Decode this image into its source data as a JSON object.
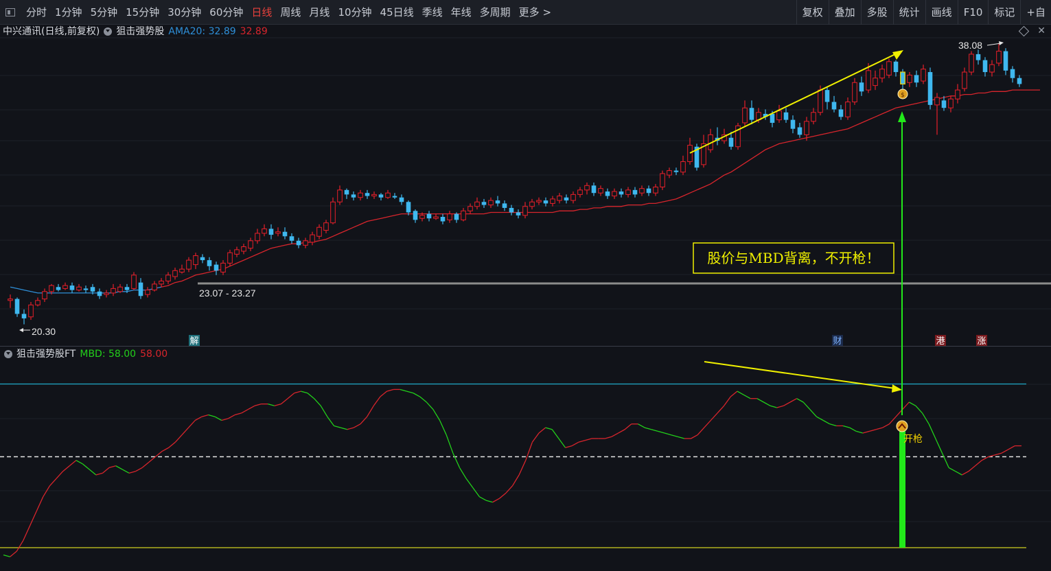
{
  "toolbar": {
    "periods": [
      "分时",
      "1分钟",
      "5分钟",
      "15分钟",
      "30分钟",
      "60分钟",
      "日线",
      "周线",
      "月线",
      "10分钟",
      "45日线",
      "季线",
      "年线",
      "多周期",
      "更多 >"
    ],
    "active_period": "日线",
    "buttons": [
      "复权",
      "叠加",
      "多股",
      "统计",
      "画线",
      "F10",
      "标记",
      "+自"
    ]
  },
  "main_panel": {
    "title": "中兴通讯(日线,前复权)",
    "indicator_name": "狙击强势股",
    "ama_label": "AMA20: 32.89",
    "ama_value2": "32.89",
    "high_label": "38.08",
    "low_label": "20.30",
    "range_label": "23.07 - 23.27",
    "event_labels": {
      "jie": "解",
      "cai": "财",
      "gang": "港",
      "zhang": "涨"
    },
    "divergence_note": "股价与MBD背离，不开枪！",
    "signal_icon": "money-bag-icon"
  },
  "sub_panel": {
    "indicator_name": "狙击强势股FT",
    "mbd_label": "MBD: 58.00",
    "mbd_value2": "58.00",
    "signal_label": "开枪",
    "signal_icon": "up-chevron-icon"
  },
  "colors": {
    "up": "#e8202a",
    "down": "#3fb8ef",
    "ma_red": "#d8252c",
    "ma_blue": "#2e8fd8",
    "osc_green": "#22d01a",
    "osc_red": "#d8252c",
    "annotation_yellow": "#f0f000",
    "signal_green": "#22e81a",
    "cyan_line": "#1ea8c8",
    "gray_line": "#8c8c8c"
  },
  "chart_data": [
    {
      "type": "candlestick",
      "title": "中兴通讯(日线,前复权)",
      "yrange": [
        19.5,
        39.5
      ],
      "candles": [
        [
          21.9,
          22.0,
          22.3,
          21.4
        ],
        [
          22.0,
          21.0,
          22.1,
          20.8
        ],
        [
          21.0,
          20.7,
          21.3,
          20.3
        ],
        [
          20.8,
          21.6,
          21.8,
          20.6
        ],
        [
          21.6,
          21.9,
          22.1,
          21.5
        ],
        [
          22.0,
          22.5,
          22.7,
          21.8
        ],
        [
          22.5,
          22.9,
          23.0,
          22.3
        ],
        [
          22.8,
          22.6,
          23.0,
          22.5
        ],
        [
          22.7,
          22.9,
          23.1,
          22.6
        ],
        [
          22.9,
          22.6,
          23.1,
          22.4
        ],
        [
          22.6,
          22.8,
          23.0,
          22.5
        ],
        [
          22.7,
          22.6,
          22.9,
          22.4
        ],
        [
          22.8,
          22.5,
          23.0,
          22.3
        ],
        [
          22.5,
          22.2,
          22.7,
          22.0
        ],
        [
          22.3,
          22.4,
          22.6,
          22.1
        ],
        [
          22.4,
          22.7,
          23.0,
          22.2
        ],
        [
          22.5,
          22.8,
          23.0,
          22.4
        ],
        [
          22.8,
          22.6,
          23.0,
          22.4
        ],
        [
          22.7,
          23.6,
          23.8,
          22.6
        ],
        [
          23.1,
          22.2,
          23.4,
          22.0
        ],
        [
          22.3,
          22.6,
          22.8,
          22.1
        ],
        [
          22.6,
          23.0,
          23.2,
          22.5
        ],
        [
          23.0,
          23.2,
          23.4,
          22.8
        ],
        [
          23.2,
          23.6,
          23.8,
          23.0
        ],
        [
          23.5,
          23.9,
          24.1,
          23.3
        ],
        [
          23.8,
          24.0,
          24.3,
          23.7
        ],
        [
          24.0,
          24.6,
          24.8,
          23.8
        ],
        [
          24.3,
          24.9,
          25.1,
          24.0
        ],
        [
          24.8,
          24.6,
          25.0,
          24.4
        ],
        [
          24.6,
          24.2,
          24.8,
          23.9
        ],
        [
          24.3,
          23.9,
          24.5,
          23.6
        ],
        [
          23.8,
          24.4,
          24.6,
          23.6
        ],
        [
          24.4,
          25.1,
          25.3,
          24.2
        ],
        [
          25.0,
          25.3,
          25.5,
          24.8
        ],
        [
          25.2,
          25.5,
          25.7,
          25.0
        ],
        [
          25.4,
          25.9,
          26.1,
          25.2
        ],
        [
          25.9,
          26.4,
          26.7,
          25.7
        ],
        [
          26.4,
          26.7,
          27.0,
          26.2
        ],
        [
          26.7,
          26.3,
          27.0,
          26.0
        ],
        [
          26.4,
          26.5,
          26.8,
          26.2
        ],
        [
          26.5,
          26.2,
          26.8,
          26.0
        ],
        [
          26.2,
          25.9,
          26.4,
          25.7
        ],
        [
          25.9,
          25.6,
          26.1,
          25.4
        ],
        [
          25.6,
          25.9,
          26.1,
          25.4
        ],
        [
          25.8,
          26.3,
          26.5,
          25.6
        ],
        [
          26.2,
          26.8,
          27.0,
          26.0
        ],
        [
          26.6,
          27.1,
          27.3,
          26.4
        ],
        [
          27.1,
          28.5,
          28.8,
          27.0
        ],
        [
          28.5,
          29.3,
          29.6,
          28.3
        ],
        [
          29.3,
          29.0,
          29.4,
          28.7
        ],
        [
          29.0,
          28.8,
          29.2,
          28.6
        ],
        [
          28.8,
          29.1,
          29.3,
          28.6
        ],
        [
          29.1,
          28.9,
          29.3,
          28.7
        ],
        [
          28.9,
          29.0,
          29.2,
          28.7
        ],
        [
          29.0,
          28.8,
          29.1,
          28.6
        ],
        [
          28.8,
          29.1,
          29.3,
          28.7
        ],
        [
          28.9,
          28.8,
          29.1,
          28.7
        ],
        [
          28.8,
          28.5,
          29.0,
          28.3
        ],
        [
          28.5,
          27.8,
          28.6,
          27.6
        ],
        [
          27.9,
          27.3,
          28.0,
          27.1
        ],
        [
          27.4,
          27.6,
          27.8,
          27.2
        ],
        [
          27.7,
          27.4,
          27.9,
          27.2
        ],
        [
          27.4,
          27.5,
          27.7,
          27.3
        ],
        [
          27.5,
          27.2,
          27.7,
          27.0
        ],
        [
          27.3,
          27.7,
          27.9,
          27.1
        ],
        [
          27.7,
          27.3,
          27.8,
          27.1
        ],
        [
          27.3,
          27.9,
          28.1,
          27.2
        ],
        [
          27.9,
          28.2,
          28.4,
          27.7
        ],
        [
          28.2,
          28.5,
          28.8,
          28.0
        ],
        [
          28.5,
          28.3,
          28.7,
          28.1
        ],
        [
          28.3,
          28.6,
          28.8,
          28.1
        ],
        [
          28.6,
          28.4,
          28.9,
          28.2
        ],
        [
          28.4,
          28.1,
          28.6,
          27.9
        ],
        [
          28.1,
          27.8,
          28.3,
          27.6
        ],
        [
          27.8,
          27.6,
          28.0,
          27.4
        ],
        [
          27.6,
          28.2,
          28.5,
          27.4
        ],
        [
          28.2,
          28.5,
          28.7,
          28.0
        ],
        [
          28.5,
          28.6,
          28.8,
          28.3
        ],
        [
          28.6,
          28.4,
          28.8,
          28.2
        ],
        [
          28.4,
          28.7,
          28.9,
          28.2
        ],
        [
          28.6,
          28.9,
          29.1,
          28.4
        ],
        [
          28.8,
          28.6,
          29.0,
          28.4
        ],
        [
          28.6,
          29.0,
          29.2,
          28.4
        ],
        [
          29.0,
          29.3,
          29.5,
          28.8
        ],
        [
          29.3,
          29.6,
          29.8,
          29.0
        ],
        [
          29.6,
          29.1,
          29.8,
          28.9
        ],
        [
          29.1,
          29.4,
          29.6,
          28.9
        ],
        [
          29.2,
          28.9,
          29.4,
          28.7
        ],
        [
          28.9,
          29.2,
          29.4,
          28.7
        ],
        [
          29.2,
          29.0,
          29.4,
          28.8
        ],
        [
          29.0,
          29.3,
          29.5,
          28.8
        ],
        [
          29.3,
          29.0,
          29.5,
          28.8
        ],
        [
          29.1,
          29.4,
          29.6,
          28.9
        ],
        [
          29.4,
          29.1,
          29.6,
          28.9
        ],
        [
          29.1,
          29.5,
          29.7,
          28.9
        ],
        [
          29.5,
          30.4,
          30.6,
          29.3
        ],
        [
          30.3,
          30.6,
          30.8,
          30.1
        ],
        [
          30.6,
          30.5,
          30.8,
          30.3
        ],
        [
          30.5,
          31.2,
          31.6,
          30.3
        ],
        [
          31.2,
          32.3,
          32.8,
          31.0
        ],
        [
          32.2,
          30.8,
          32.4,
          30.6
        ],
        [
          31.0,
          32.4,
          33.0,
          30.8
        ],
        [
          32.0,
          33.0,
          33.4,
          31.8
        ],
        [
          32.8,
          32.6,
          33.5,
          32.3
        ],
        [
          32.6,
          33.0,
          33.4,
          32.4
        ],
        [
          32.8,
          32.2,
          33.2,
          32.0
        ],
        [
          32.2,
          33.6,
          33.8,
          32.0
        ],
        [
          33.8,
          34.8,
          35.3,
          33.6
        ],
        [
          34.8,
          34.0,
          35.3,
          33.7
        ],
        [
          34.0,
          34.5,
          34.8,
          33.8
        ],
        [
          34.4,
          34.2,
          34.7,
          34.0
        ],
        [
          34.4,
          33.8,
          34.6,
          33.5
        ],
        [
          34.0,
          34.6,
          35.0,
          33.8
        ],
        [
          34.5,
          34.0,
          34.8,
          33.8
        ],
        [
          34.0,
          33.4,
          34.3,
          33.1
        ],
        [
          33.5,
          33.0,
          33.8,
          32.8
        ],
        [
          33.0,
          33.9,
          34.2,
          32.6
        ],
        [
          33.9,
          34.5,
          34.8,
          33.7
        ],
        [
          34.5,
          36.0,
          36.3,
          34.3
        ],
        [
          36.0,
          35.2,
          36.2,
          34.7
        ],
        [
          35.2,
          34.7,
          35.6,
          34.5
        ],
        [
          34.7,
          34.2,
          35.0,
          34.0
        ],
        [
          34.2,
          35.2,
          35.5,
          34.0
        ],
        [
          35.2,
          36.5,
          36.8,
          35.0
        ],
        [
          36.5,
          35.9,
          36.9,
          35.6
        ],
        [
          36.0,
          37.3,
          37.8,
          35.8
        ],
        [
          36.3,
          36.8,
          37.3,
          36.0
        ],
        [
          36.8,
          37.4,
          37.7,
          36.5
        ],
        [
          37.0,
          37.9,
          38.1,
          36.8
        ],
        [
          37.9,
          37.2,
          38.0,
          36.9
        ],
        [
          37.2,
          36.4,
          37.4,
          36.0
        ],
        [
          36.5,
          37.0,
          37.2,
          36.2
        ],
        [
          37.0,
          36.5,
          37.3,
          36.2
        ],
        [
          36.6,
          37.4,
          37.7,
          36.4
        ],
        [
          37.2,
          35.0,
          37.5,
          34.7
        ],
        [
          35.0,
          35.5,
          35.8,
          33.0
        ],
        [
          35.3,
          34.8,
          35.6,
          34.6
        ],
        [
          34.8,
          35.4,
          35.6,
          34.5
        ],
        [
          35.4,
          36.0,
          36.4,
          35.1
        ],
        [
          36.1,
          37.2,
          37.5,
          35.9
        ],
        [
          37.2,
          38.4,
          38.6,
          37.0
        ],
        [
          38.4,
          38.0,
          38.7,
          37.7
        ],
        [
          38.0,
          37.2,
          38.2,
          36.9
        ],
        [
          37.2,
          37.7,
          38.0,
          36.9
        ],
        [
          37.8,
          38.6,
          39.1,
          37.6
        ],
        [
          38.6,
          37.3,
          38.8,
          37.0
        ],
        [
          37.4,
          36.8,
          37.6,
          36.5
        ],
        [
          36.8,
          36.4,
          37.0,
          36.2
        ]
      ],
      "ama20": [
        22.8,
        22.7,
        22.6,
        22.5,
        22.4,
        22.4,
        22.4,
        22.4,
        22.4,
        22.4,
        22.4,
        22.4,
        22.4,
        22.4,
        22.4,
        22.4,
        22.5,
        22.5,
        22.6,
        22.6,
        22.6,
        22.7,
        22.8,
        22.9,
        23.1,
        23.2,
        23.4,
        23.6,
        23.7,
        23.8,
        23.9,
        24.0,
        24.2,
        24.4,
        24.6,
        24.8,
        25.0,
        25.2,
        25.4,
        25.5,
        25.6,
        25.7,
        25.7,
        25.8,
        25.8,
        25.9,
        26.0,
        26.2,
        26.4,
        26.6,
        26.8,
        27.0,
        27.2,
        27.3,
        27.4,
        27.5,
        27.6,
        27.7,
        27.7,
        27.7,
        27.7,
        27.7,
        27.7,
        27.7,
        27.7,
        27.7,
        27.7,
        27.7,
        27.7,
        27.7,
        27.8,
        27.8,
        27.8,
        27.8,
        27.8,
        27.8,
        27.8,
        27.8,
        27.8,
        27.8,
        27.9,
        27.9,
        27.9,
        28.0,
        28.0,
        28.1,
        28.1,
        28.2,
        28.2,
        28.2,
        28.3,
        28.3,
        28.3,
        28.4,
        28.4,
        28.5,
        28.6,
        28.7,
        28.9,
        29.1,
        29.3,
        29.5,
        29.7,
        30.0,
        30.3,
        30.5,
        30.8,
        31.1,
        31.4,
        31.7,
        32.0,
        32.2,
        32.4,
        32.5,
        32.6,
        32.7,
        32.8,
        32.9,
        33.0,
        33.1,
        33.2,
        33.3,
        33.4,
        33.6,
        33.8,
        34.0,
        34.2,
        34.4,
        34.6,
        34.8,
        34.9,
        35.0,
        35.1,
        35.2,
        35.3,
        35.4,
        35.5,
        35.6,
        35.6,
        35.7,
        35.7,
        35.8,
        35.8,
        35.9,
        35.9,
        35.9,
        36.0,
        36.0,
        36.0,
        36.0,
        36.0
      ]
    },
    {
      "type": "line",
      "title": "狙击强势股FT",
      "yrange": [
        0,
        100
      ],
      "reference_lines": [
        90,
        50,
        0
      ],
      "mbd": [
        -4,
        -5,
        -2,
        4,
        12,
        20,
        28,
        34,
        38,
        42,
        45,
        48,
        46,
        43,
        40,
        41,
        44,
        45,
        43,
        41,
        42,
        44,
        47,
        50,
        53,
        55,
        58,
        62,
        66,
        70,
        72,
        73,
        72,
        70,
        71,
        73,
        74,
        76,
        78,
        79,
        79,
        78,
        79,
        82,
        85,
        86,
        85,
        82,
        78,
        72,
        67,
        66,
        65,
        66,
        68,
        72,
        78,
        83,
        86,
        87,
        87,
        86,
        85,
        83,
        80,
        76,
        70,
        62,
        52,
        44,
        38,
        33,
        28,
        26,
        25,
        27,
        30,
        34,
        40,
        48,
        58,
        63,
        66,
        65,
        60,
        55,
        56,
        58,
        59,
        60,
        60,
        60,
        61,
        63,
        65,
        68,
        68,
        66,
        65,
        64,
        63,
        62,
        61,
        60,
        60,
        62,
        66,
        70,
        74,
        78,
        83,
        86,
        84,
        82,
        82,
        80,
        78,
        77,
        78,
        80,
        82,
        80,
        76,
        72,
        70,
        68,
        67,
        67,
        66,
        64,
        63,
        64,
        65,
        66,
        68,
        72,
        76,
        80,
        78,
        74,
        68,
        60,
        52,
        44,
        42,
        40,
        42,
        45,
        48,
        50,
        51,
        52,
        54,
        56,
        56
      ]
    }
  ]
}
